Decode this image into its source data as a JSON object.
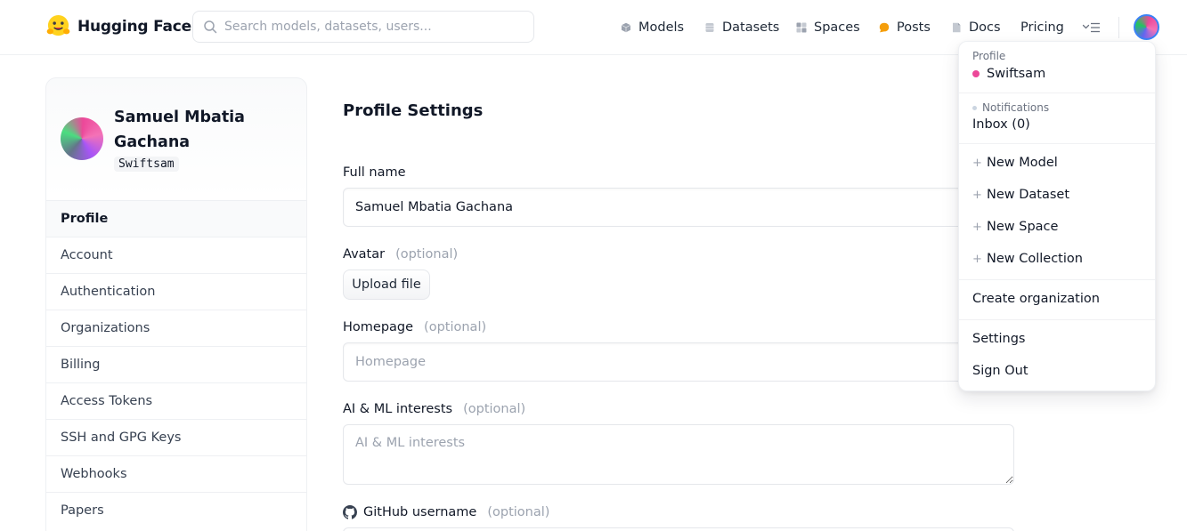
{
  "header": {
    "brand": "Hugging Face",
    "search_placeholder": "Search models, datasets, users...",
    "nav": {
      "models": "Models",
      "datasets": "Datasets",
      "spaces": "Spaces",
      "posts": "Posts",
      "docs": "Docs",
      "pricing": "Pricing"
    },
    "icons": [
      "huggingface-logo-icon",
      "search-icon",
      "models-cube-icon",
      "datasets-cylinder-icon",
      "spaces-grid-icon",
      "posts-bubble-icon",
      "docs-icon",
      "more-menu-icon",
      "avatar"
    ]
  },
  "sidebar": {
    "name": "Samuel Mbatia Gachana",
    "handle": "Swiftsam",
    "items": [
      {
        "label": "Profile",
        "active": true
      },
      {
        "label": "Account"
      },
      {
        "label": "Authentication"
      },
      {
        "label": "Organizations"
      },
      {
        "label": "Billing"
      },
      {
        "label": "Access Tokens"
      },
      {
        "label": "SSH and GPG Keys"
      },
      {
        "label": "Webhooks"
      },
      {
        "label": "Papers"
      }
    ]
  },
  "main": {
    "title": "Profile Settings",
    "fullname_label": "Full name",
    "fullname_value": "Samuel Mbatia Gachana",
    "avatar_label": "Avatar",
    "optional": "(optional)",
    "upload_label": "Upload file",
    "homepage_label": "Homepage",
    "homepage_placeholder": "Homepage",
    "interests_label": "AI & ML interests",
    "interests_placeholder": "AI & ML interests",
    "github_label": "GitHub username"
  },
  "dropdown": {
    "profile_caption": "Profile",
    "username": "Swiftsam",
    "notifications_caption": "Notifications",
    "inbox": "Inbox (0)",
    "new_model": "New Model",
    "new_dataset": "New Dataset",
    "new_space": "New Space",
    "new_collection": "New Collection",
    "create_org": "Create organization",
    "settings": "Settings",
    "sign_out": "Sign Out"
  },
  "colors": {
    "posts_icon": "#f59e0b",
    "avatar_ring": "#3b82f6",
    "user_dot": "#ec4899",
    "muted_text": "#9ca3af"
  }
}
